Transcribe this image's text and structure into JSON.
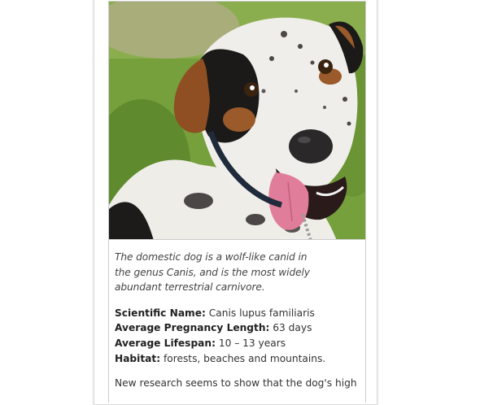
{
  "article": {
    "caption_line1": "The domestic dog is a wolf-like canid in",
    "caption_line2": "the genus Canis, and is the most widely",
    "caption_line3": "abundant terrestrial carnivore.",
    "facts": [
      {
        "label": "Scientific Name:",
        "value": " Canis lupus familiaris"
      },
      {
        "label": "Average Pregnancy Length:",
        "value": " 63 days"
      },
      {
        "label": "Average Lifespan:",
        "value": " 10 – 13 years"
      },
      {
        "label": "Habitat:",
        "value": " forests, beaches and mountains."
      }
    ],
    "research_text": "New research seems to show that the dog's high"
  },
  "colors": {
    "grass": "#6f9a3a",
    "fur_white": "#efeeea",
    "fur_black": "#1c1a19",
    "fur_tan": "#9a5a2a",
    "tongue": "#e07d9a"
  }
}
